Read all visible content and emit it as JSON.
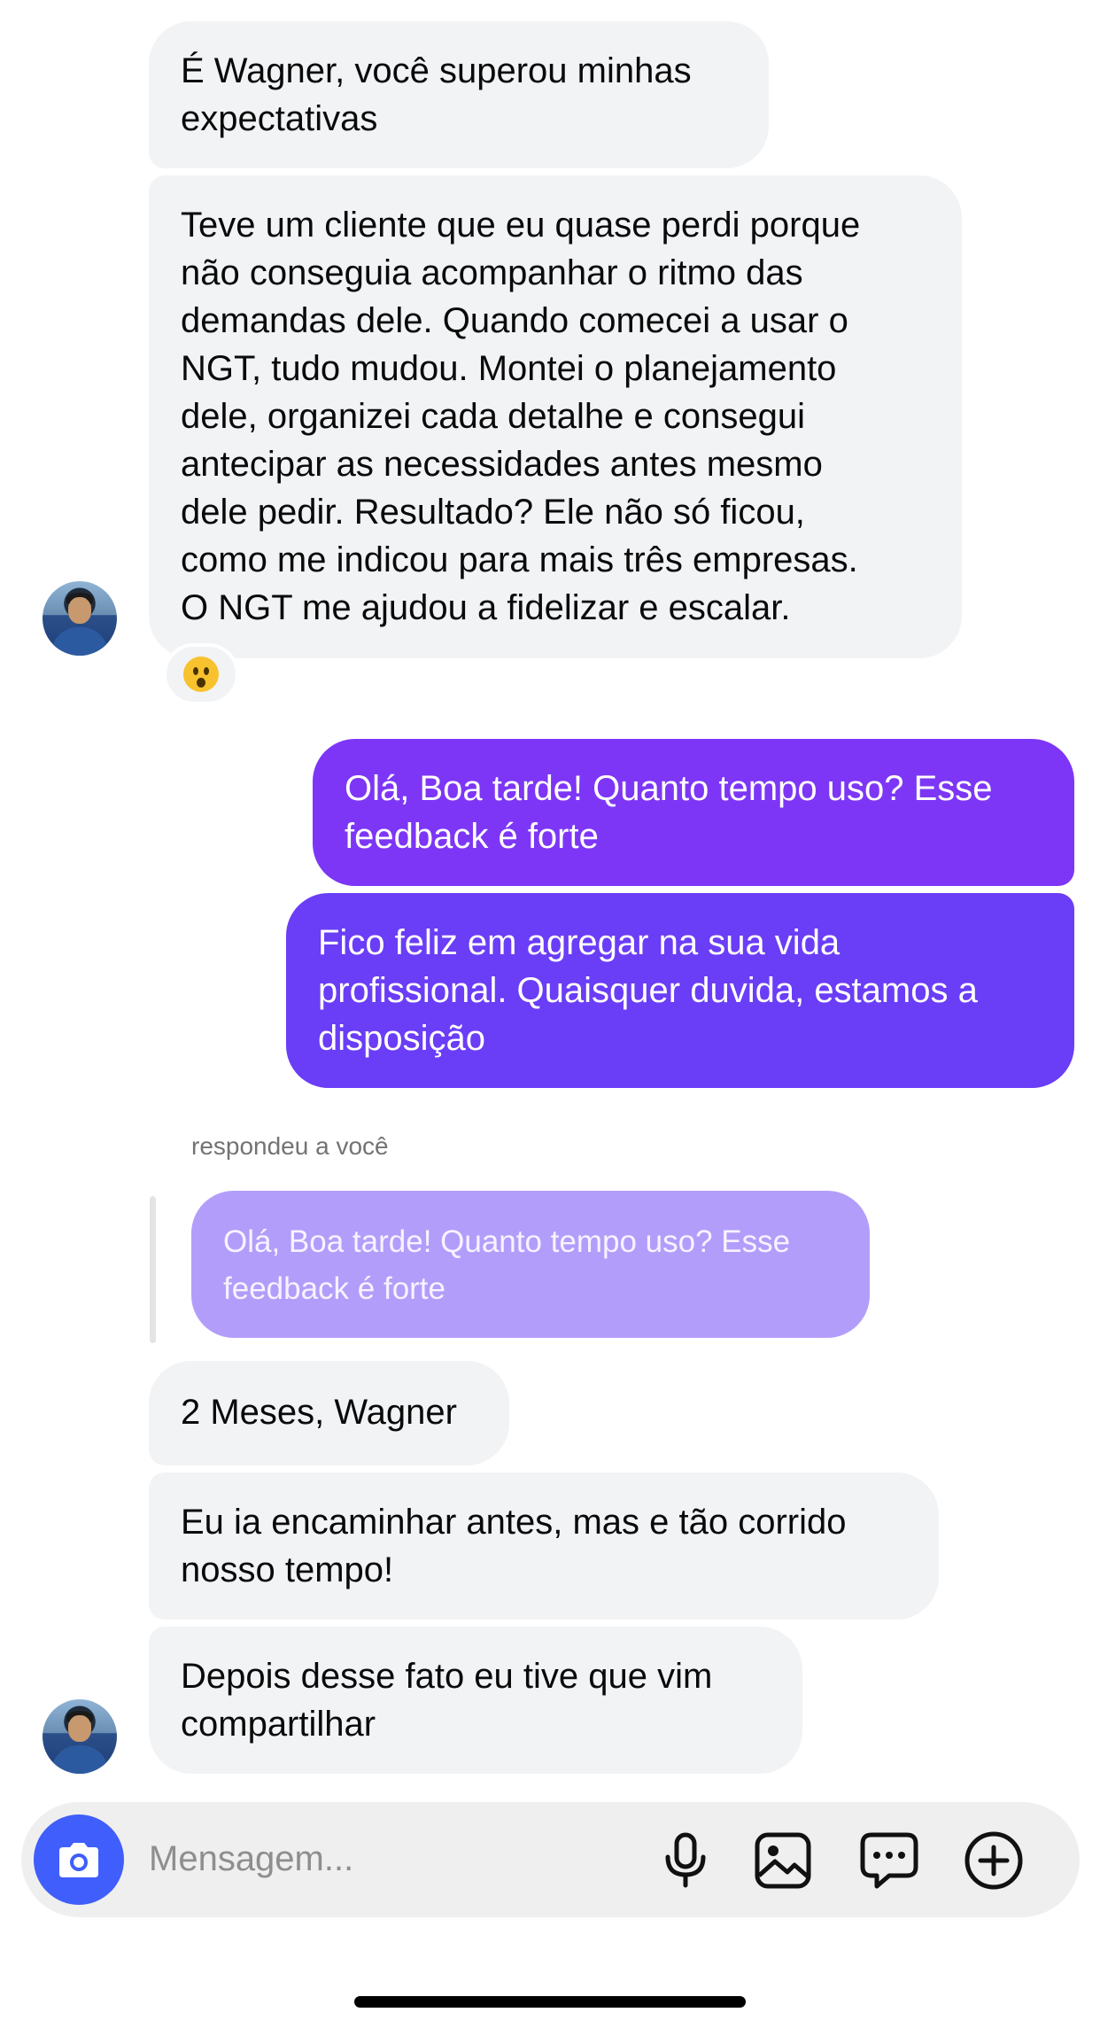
{
  "messages": [
    {
      "text": "É Wagner, você superou minhas\nexpectativas"
    },
    {
      "text": "Teve um cliente que eu quase perdi porque\nnão conseguia acompanhar o ritmo das\ndemandas dele. Quando comecei a usar o\nNGT, tudo mudou. Montei o planejamento\ndele, organizei cada detalhe e consegui\nantecipar as necessidades antes mesmo\ndele pedir. Resultado? Ele não só ficou,\ncomo me indicou para mais três empresas.\nO NGT me ajudou a fidelizar e escalar."
    },
    {
      "text": "Olá, Boa tarde! Quanto tempo uso? Esse\nfeedback é forte"
    },
    {
      "text": "Fico feliz em agregar na sua vida\nprofissional. Quaisquer duvida, estamos a\ndisposição"
    },
    {
      "text": "2 Meses, Wagner"
    },
    {
      "text": "Eu ia encaminhar antes, mas e tão corrido\nnosso tempo!"
    },
    {
      "text": "Depois desse fato eu tive que vim\ncompartilhar"
    }
  ],
  "reply": {
    "meta": "respondeu a você",
    "quoted": "Olá, Boa tarde! Quanto tempo uso? Esse\nfeedback é forte"
  },
  "composer": {
    "placeholder": "Mensagem...",
    "icons": [
      "camera-icon",
      "microphone-icon",
      "gallery-icon",
      "sticker-chat-icon",
      "plus-circle-icon"
    ]
  },
  "colors": {
    "incoming_bubble": "#f2f3f5",
    "outgoing_top": "#7d36f6",
    "outgoing_bottom": "#6a3df7",
    "quoted_bubble": "#b39dfb",
    "camera_button": "#3f5efb"
  }
}
